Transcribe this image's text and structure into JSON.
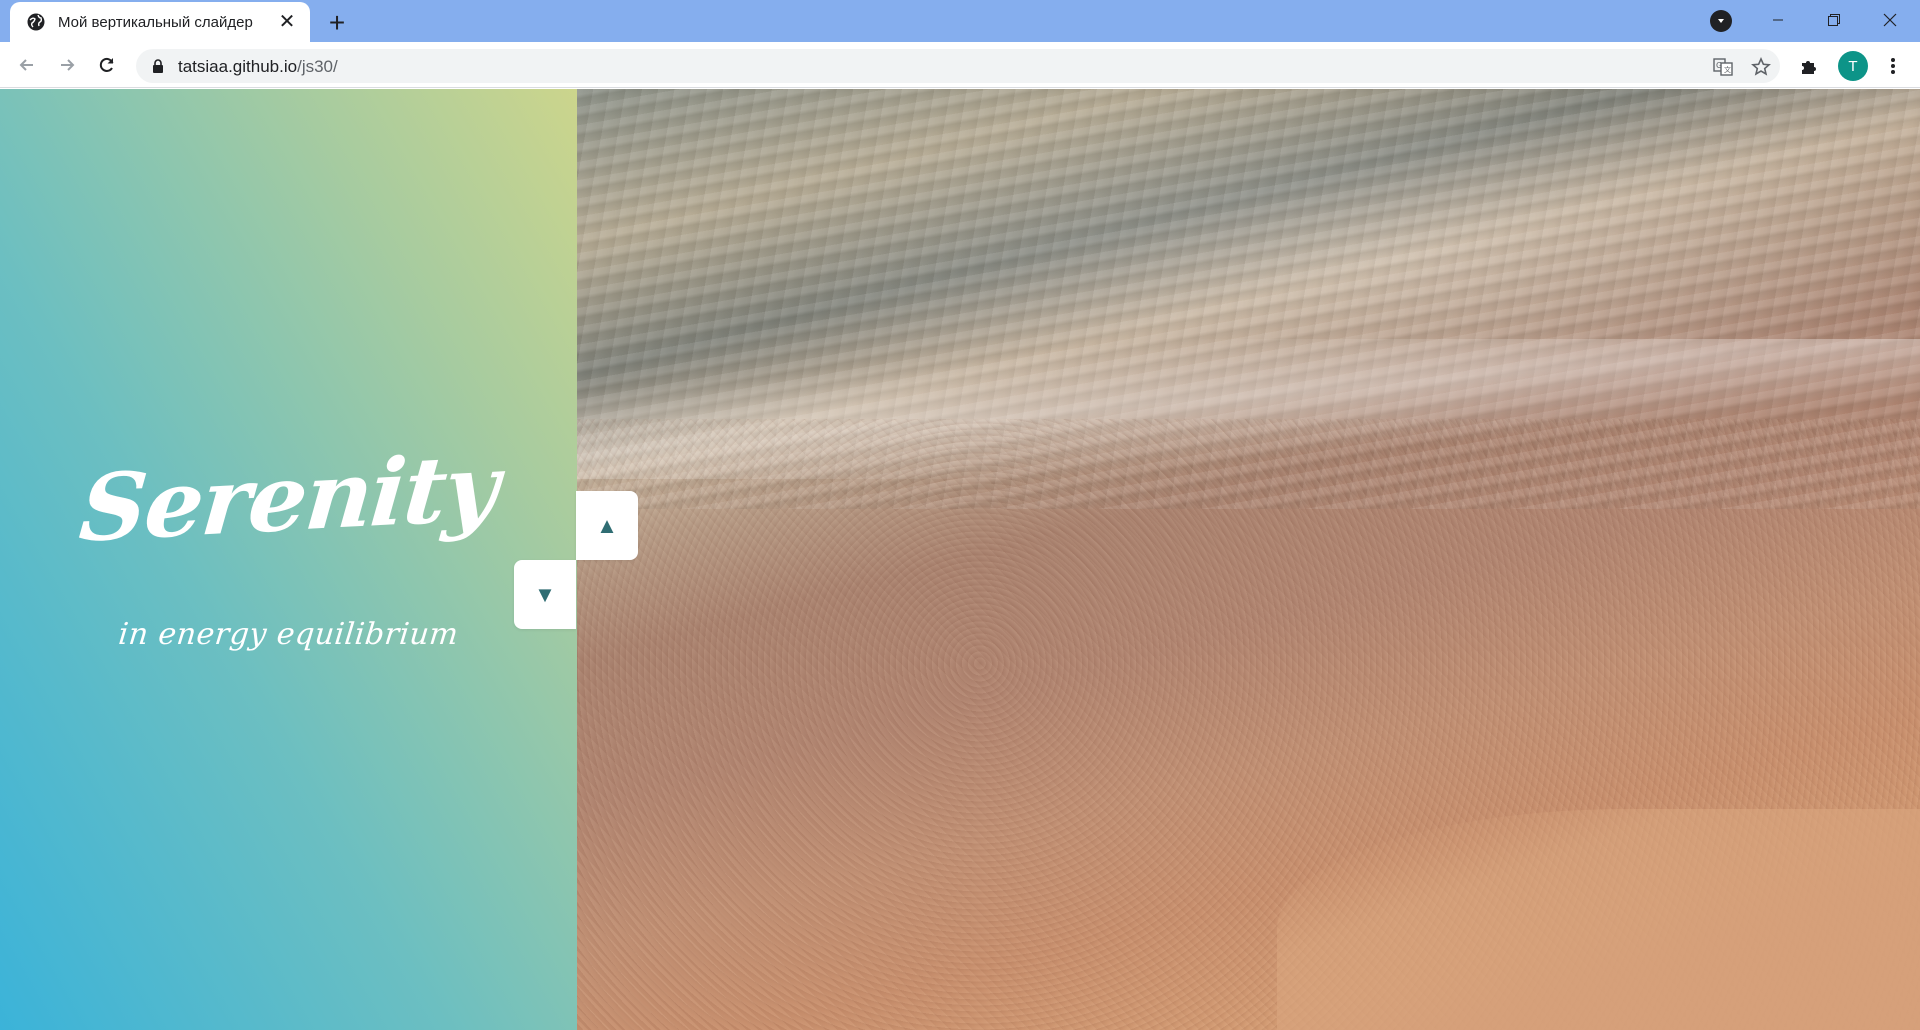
{
  "browser": {
    "tab_title": "Мой вертикальный слайдер",
    "new_tab_symbol": "+",
    "url_host": "tatsiaa.github.io",
    "url_path": "/js30/",
    "profile_initial": "T",
    "icons": {
      "favicon": "globe-icon",
      "back": "arrow-left-icon",
      "forward": "arrow-right-icon",
      "reload": "reload-icon",
      "lock": "lock-icon",
      "translate": "translate-icon",
      "bookmark": "star-icon",
      "extensions": "puzzle-icon",
      "menu": "kebab-menu-icon"
    },
    "colors": {
      "titlebar": "#85aeee",
      "profile": "#0d9488"
    }
  },
  "slider": {
    "title": "Serenity",
    "subtitle": "in energy equilibrium",
    "up_arrow": "▲",
    "down_arrow": "▼",
    "colors": {
      "gradient_start": "#3bb3d9",
      "gradient_end": "#ccd58c",
      "arrow": "#2f6d73"
    }
  }
}
